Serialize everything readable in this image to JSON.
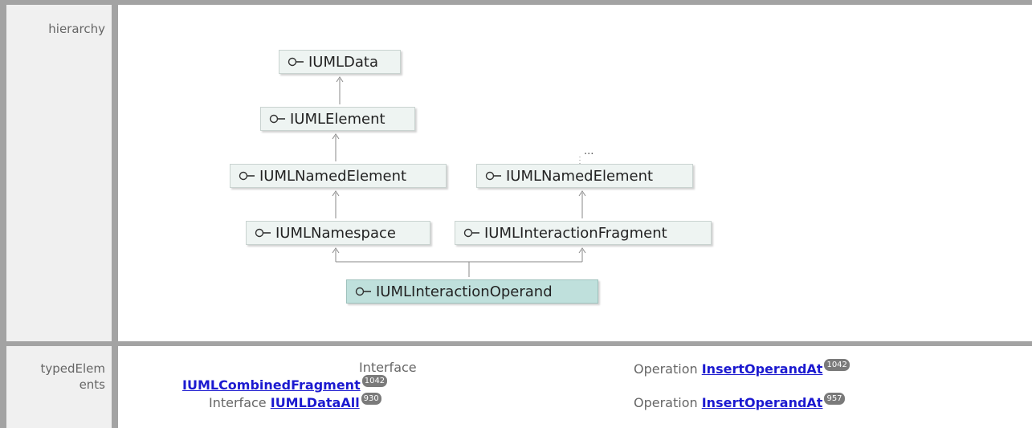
{
  "rows": {
    "hierarchy_label": "hierarchy",
    "typed_label": "typedElem\nents"
  },
  "diagram": {
    "nodes": {
      "uml_data": "IUMLData",
      "uml_element": "IUMLElement",
      "uml_named_element_left": "IUMLNamedElement",
      "uml_named_element_right": "IUMLNamedElement",
      "uml_namespace": "IUMLNamespace",
      "uml_interaction_fragment": "IUMLInteractionFragment",
      "uml_interaction_operand": "IUMLInteractionOperand"
    },
    "ellipsis": "..."
  },
  "typed_elements": [
    {
      "left_kind": "Interface",
      "left_name": "IUMLCombinedFragment",
      "left_badge": "1042",
      "right_kind": "Operation",
      "right_name": "InsertOperandAt",
      "right_badge": "1042"
    },
    {
      "left_kind": "Interface",
      "left_name": "IUMLDataAll",
      "left_badge": "930",
      "right_kind": "Operation",
      "right_name": "InsertOperandAt",
      "right_badge": "957"
    }
  ],
  "colors": {
    "node_fill": "#eef4f2",
    "node_selected_fill": "#bfe0dc",
    "link": "#1c1ad0",
    "separator": "#a3a3a3"
  }
}
